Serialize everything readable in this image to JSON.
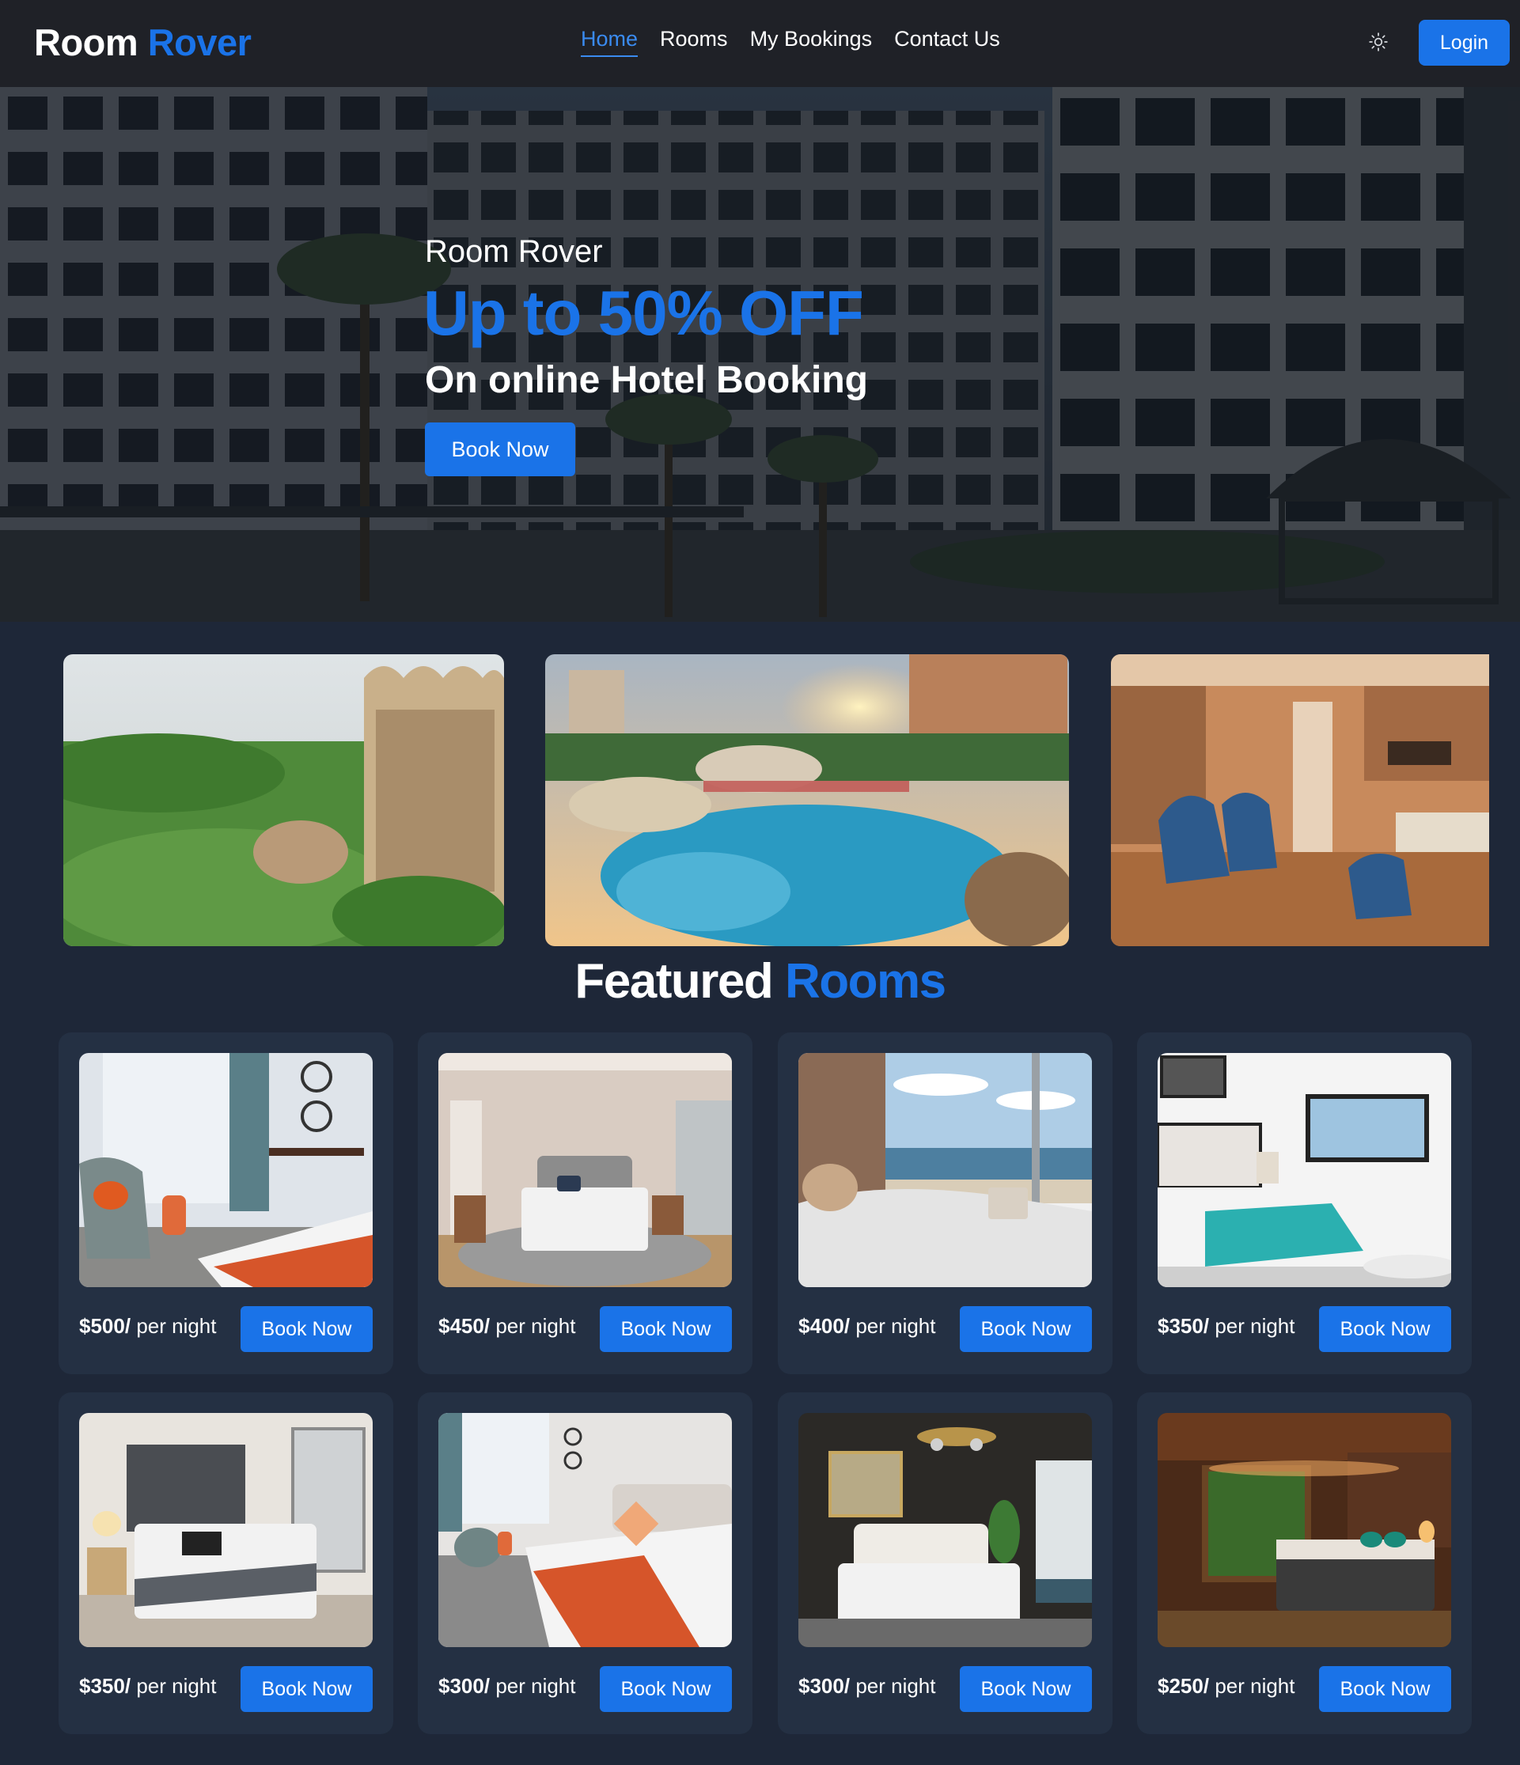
{
  "navbar": {
    "brand_part1": "Room",
    "brand_part2": "Rover",
    "links": [
      {
        "label": "Home",
        "active": true
      },
      {
        "label": "Rooms",
        "active": false
      },
      {
        "label": "My Bookings",
        "active": false
      },
      {
        "label": "Contact Us",
        "active": false
      }
    ],
    "theme_icon": "sun-icon",
    "login_label": "Login"
  },
  "hero": {
    "subtitle": "Room Rover",
    "title": "Up to 50% OFF",
    "tagline": "On online Hotel Booking",
    "button_label": "Book Now"
  },
  "gallery": [
    {
      "name": "hotel-garden-photo"
    },
    {
      "name": "resort-pool-photo"
    },
    {
      "name": "hotel-lounge-photo"
    }
  ],
  "featured": {
    "title_part1": "Featured",
    "title_part2": "Rooms"
  },
  "rooms": [
    {
      "price": "$500/",
      "unit": "per night",
      "button": "Book Now"
    },
    {
      "price": "$450/",
      "unit": "per night",
      "button": "Book Now"
    },
    {
      "price": "$400/",
      "unit": "per night",
      "button": "Book Now"
    },
    {
      "price": "$350/",
      "unit": "per night",
      "button": "Book Now"
    },
    {
      "price": "$350/",
      "unit": "per night",
      "button": "Book Now"
    },
    {
      "price": "$300/",
      "unit": "per night",
      "button": "Book Now"
    },
    {
      "price": "$300/",
      "unit": "per night",
      "button": "Book Now"
    },
    {
      "price": "$250/",
      "unit": "per night",
      "button": "Book Now"
    }
  ],
  "colors": {
    "accent": "#1a73e8",
    "background": "#1e2738",
    "navbar": "#1f2127",
    "card": "#243043"
  }
}
